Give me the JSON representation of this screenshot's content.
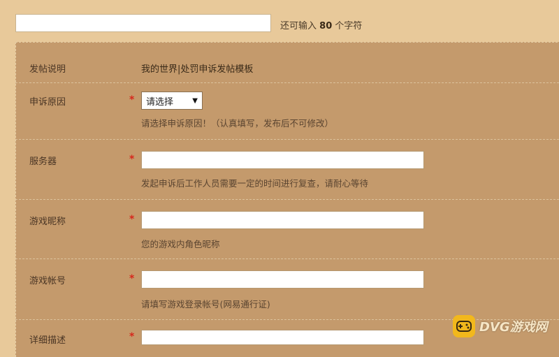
{
  "title_field": {
    "value": "",
    "hint_prefix": "还可输入",
    "hint_count": "80",
    "hint_suffix": "个字符"
  },
  "form": {
    "description": {
      "label": "发帖说明",
      "value": "我的世界|处罚申诉发帖模板"
    },
    "reason": {
      "label": "申诉原因",
      "required_mark": "*",
      "selected": "请选择",
      "hint": "请选择申诉原因！（认真填写，发布后不可修改）"
    },
    "server": {
      "label": "服务器",
      "required_mark": "*",
      "value": "",
      "hint": "发起申诉后工作人员需要一定的时间进行复查，请耐心等待"
    },
    "nickname": {
      "label": "游戏昵称",
      "required_mark": "*",
      "value": "",
      "hint": "您的游戏内角色昵称"
    },
    "account": {
      "label": "游戏帐号",
      "required_mark": "*",
      "value": "",
      "hint": "请填写游戏登录帐号(网易通行证)"
    },
    "detail": {
      "label": "详细描述",
      "required_mark": "*",
      "value": ""
    }
  },
  "watermark": {
    "text": "DVG游戏网",
    "icon": "gamepad-icon"
  },
  "colors": {
    "page_bg": "#e8c99a",
    "panel_bg": "#c49a6c",
    "required": "#d6281c",
    "logo": "#f2b81c"
  }
}
